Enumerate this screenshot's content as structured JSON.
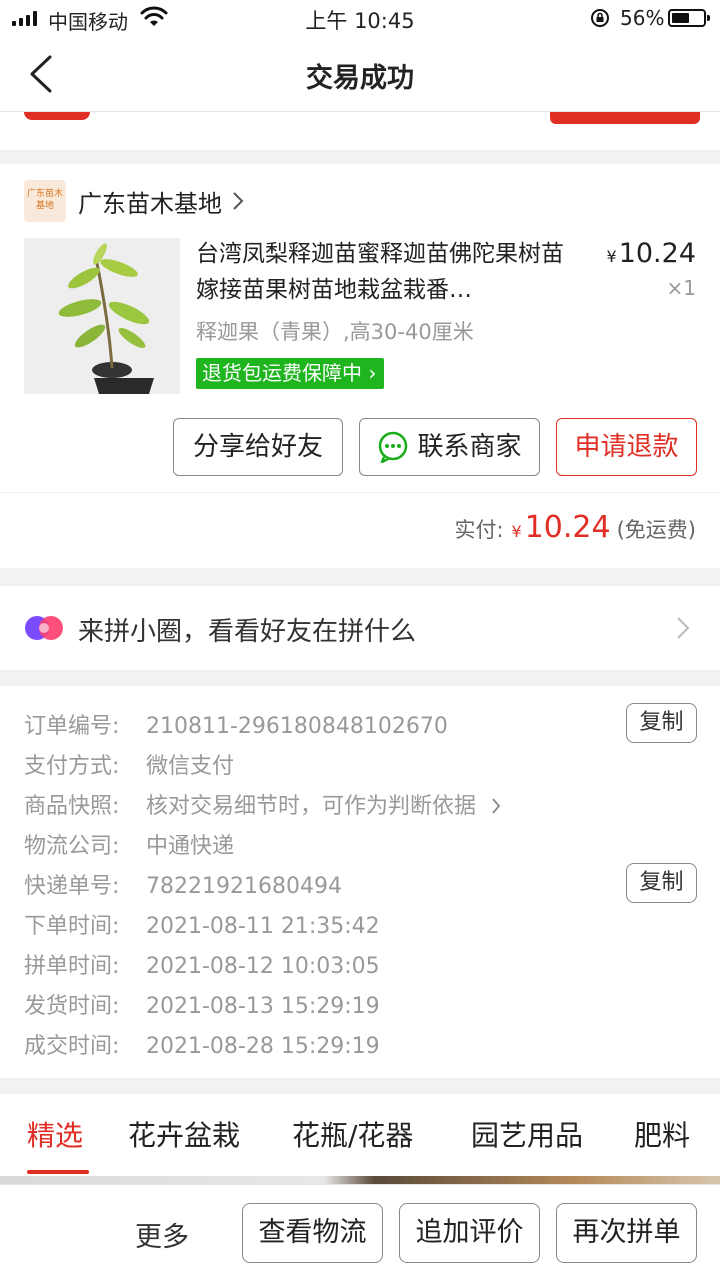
{
  "status_bar": {
    "carrier": "中国移动",
    "time": "上午 10:45",
    "battery": "56%",
    "battery_level": 0.56
  },
  "nav": {
    "title": "交易成功"
  },
  "order": {
    "shop": {
      "logo_text": "广东苗木基地",
      "name": "广东苗木基地"
    },
    "product": {
      "title": "台湾凤梨释迦苗蜜释迦苗佛陀果树苗嫁接苗果树苗地栽盆栽番…",
      "price_symbol": "¥",
      "price": "10.24",
      "quantity": "×1",
      "spec": "释迦果（青果）,高30-40厘米",
      "guarantee_badge": "退货包运费保障中"
    },
    "actions": {
      "share": "分享给好友",
      "contact": "联系商家",
      "refund": "申请退款"
    },
    "paid": {
      "label": "实付:",
      "symbol": "¥",
      "amount": "10.24",
      "note": "(免运费)"
    }
  },
  "group": {
    "text": "来拼小圈，看看好友在拼什么"
  },
  "details": {
    "order_no": {
      "label": "订单编号:",
      "value": "210811-296180848102670",
      "copy": "复制"
    },
    "payment": {
      "label": "支付方式:",
      "value": "微信支付"
    },
    "snapshot": {
      "label": "商品快照:",
      "value": "核对交易细节时，可作为判断依据"
    },
    "logistics_company": {
      "label": "物流公司:",
      "value": "中通快递"
    },
    "tracking_no": {
      "label": "快递单号:",
      "value": "78221921680494",
      "copy": "复制"
    },
    "order_time": {
      "label": "下单时间:",
      "value": "2021-08-11 21:35:42"
    },
    "group_time": {
      "label": "拼单时间:",
      "value": "2021-08-12 10:03:05"
    },
    "ship_time": {
      "label": "发货时间:",
      "value": "2021-08-13 15:29:19"
    },
    "complete_time": {
      "label": "成交时间:",
      "value": "2021-08-28 15:29:19"
    }
  },
  "tabs": [
    "精选",
    "花卉盆栽",
    "花瓶/花器",
    "园艺用品",
    "肥料"
  ],
  "active_tab": "精选",
  "bottom_bar": {
    "more": "更多",
    "logistics": "查看物流",
    "review": "追加评价",
    "rebuy": "再次拼单"
  },
  "colors": {
    "accent": "#e02e24",
    "guarantee_green": "#1fb51f",
    "wechat_green": "#1aad19"
  }
}
